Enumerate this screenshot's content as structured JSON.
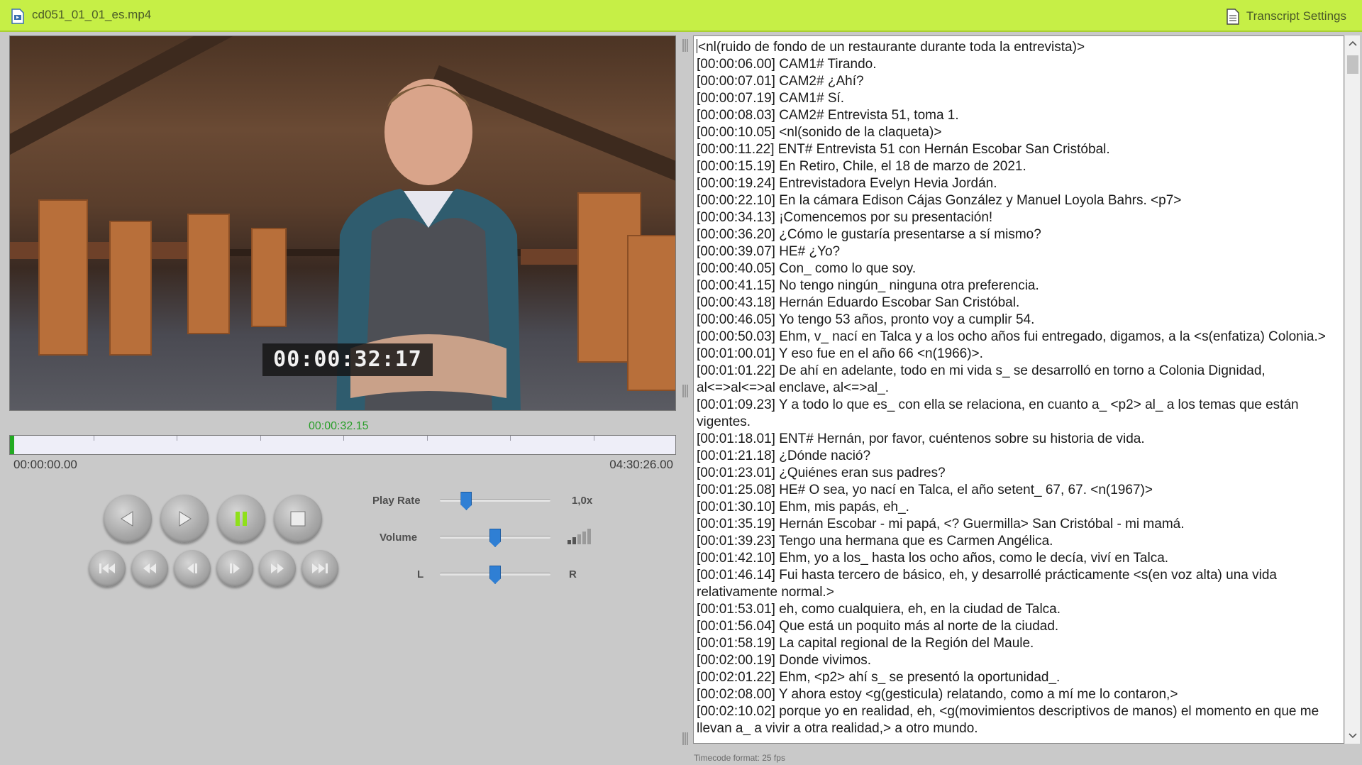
{
  "window": {
    "file_name": "cd051_01_01_es.mp4",
    "settings_label": "Transcript Settings"
  },
  "player": {
    "overlay_timecode": "00:00:32:17",
    "current_time": "00:00:32.15",
    "start_time": "00:00:00.00",
    "end_time": "04:30:26.00",
    "progress_fraction": 0.0021,
    "play_rate": {
      "label": "Play Rate",
      "value": "1,0x",
      "level": 0.24
    },
    "volume": {
      "label": "Volume",
      "level": 0.5,
      "bars_on": 2,
      "bars_total": 5
    },
    "balance": {
      "left": "L",
      "right": "R",
      "level": 0.5
    }
  },
  "transcript": {
    "lines": [
      "<nl(ruido de fondo de un restaurante durante toda la entrevista)>",
      "[00:00:06.00] CAM1# Tirando.",
      "[00:00:07.01] CAM2# ¿Ahí?",
      "[00:00:07.19] CAM1# Sí.",
      "[00:00:08.03] CAM2# Entrevista 51, toma 1.",
      "[00:00:10.05] <nl(sonido de la claqueta)>",
      "[00:00:11.22] ENT# Entrevista 51 con Hernán Escobar San Cristóbal.",
      "[00:00:15.19] En Retiro, Chile, el 18 de marzo de 2021.",
      "[00:00:19.24] Entrevistadora Evelyn Hevia Jordán.",
      "[00:00:22.10] En la cámara Edison Cájas González y Manuel Loyola Bahrs. <p7>",
      "[00:00:34.13] ¡Comencemos por su presentación!",
      "[00:00:36.20] ¿Cómo le gustaría presentarse a sí mismo?",
      "[00:00:39.07] HE# ¿Yo?",
      "[00:00:40.05] Con_ como lo que soy.",
      "[00:00:41.15] No tengo ningún_ ninguna otra preferencia.",
      "[00:00:43.18] Hernán Eduardo Escobar San Cristóbal.",
      "[00:00:46.05] Yo tengo 53 años, pronto voy a cumplir 54.",
      "[00:00:50.03] Ehm, v_ nací en Talca y a los ocho años fui entregado, digamos, a la <s(enfatiza) Colonia.>",
      "[00:01:00.01] Y eso fue en el año 66 <n(1966)>.",
      "[00:01:01.22] De ahí en adelante, todo en mi vida s_ se desarrolló en torno a Colonia Dignidad, al<=>al<=>al enclave, al<=>al_.",
      "[00:01:09.23] Y a todo lo que es_ con ella se relaciona, en cuanto a_ <p2> al_ a los temas que están vigentes.",
      "[00:01:18.01] ENT# Hernán, por favor, cuéntenos sobre su historia de vida.",
      "[00:01:21.18] ¿Dónde nació?",
      "[00:01:23.01] ¿Quiénes eran sus padres?",
      "[00:01:25.08] HE# O sea, yo nací en Talca, el año setent_ 67, 67. <n(1967)>",
      "[00:01:30.10] Ehm, mis papás, eh_.",
      "[00:01:35.19] Hernán Escobar - mi papá, <? Guermilla> San Cristóbal - mi mamá.",
      "[00:01:39.23] Tengo una hermana que es Carmen Angélica.",
      "[00:01:42.10] Ehm, yo a los_ hasta los ocho años, como le decía, viví en Talca.",
      "[00:01:46.14] Fui hasta tercero de básico, eh, y desarrollé prácticamente <s(en voz alta) una vida relativamente normal.>",
      "[00:01:53.01] eh, como cualquiera, eh, en la ciudad de Talca.",
      "[00:01:56.04] Que está un poquito más al norte de la ciudad.",
      "[00:01:58.19] La capital regional de la Región del Maule.",
      "[00:02:00.19] Donde vivimos.",
      "[00:02:01.22] Ehm, <p2> ahí s_ se presentó la oportunidad_.",
      "[00:02:08.00] Y ahora estoy <g(gesticula) relatando, como a mí me lo contaron,>",
      "[00:02:10.02] porque yo en realidad, eh, <g(movimientos descriptivos de manos) el momento en que me llevan a_ a vivir a otra realidad,> a otro mundo."
    ]
  },
  "status": {
    "timecode_format": "Timecode format: 25 fps"
  },
  "colors": {
    "title_bar": "#c6ef46",
    "current_time": "#2a9e2a",
    "pause_accent": "#8fe01a",
    "slider_thumb": "#2f7fd4"
  },
  "icons": {
    "file": "video-file-icon",
    "settings": "document-icon",
    "rewind": "rewind-icon",
    "play": "play-icon",
    "pause": "pause-icon",
    "stop": "stop-icon",
    "skip_start": "skip-to-start-icon",
    "fast_back": "fast-backward-icon",
    "frame_back": "frame-back-icon",
    "frame_forward": "frame-forward-icon",
    "fast_forward": "fast-forward-icon",
    "skip_end": "skip-to-end-icon"
  }
}
